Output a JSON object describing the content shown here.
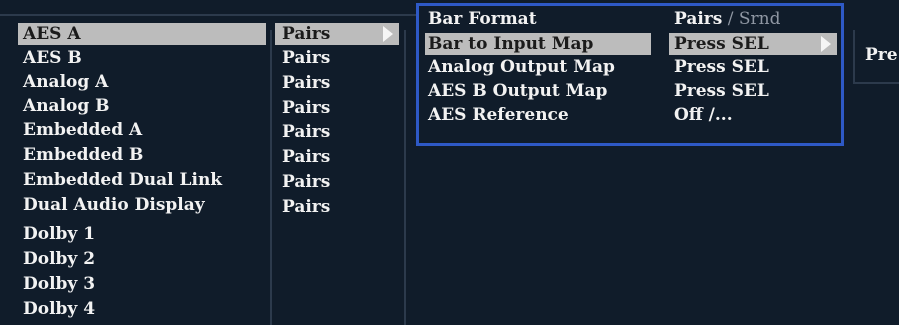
{
  "left_menu": {
    "items": [
      {
        "label": "AES A",
        "value": "Pairs"
      },
      {
        "label": "AES B",
        "value": "Pairs"
      },
      {
        "label": "Analog A",
        "value": "Pairs"
      },
      {
        "label": "Analog B",
        "value": "Pairs"
      },
      {
        "label": "Embedded A",
        "value": "Pairs"
      },
      {
        "label": "Embedded B",
        "value": "Pairs"
      },
      {
        "label": "Embedded Dual Link",
        "value": "Pairs"
      },
      {
        "label": "Dual Audio Display",
        "value": "Pairs"
      },
      {
        "label": "Dolby 1"
      },
      {
        "label": "Dolby 2"
      },
      {
        "label": "Dolby 3"
      },
      {
        "label": "Dolby 4"
      }
    ]
  },
  "submenu": {
    "items": [
      {
        "label": "Bar Format",
        "value": "Pairs",
        "value_alt": " / Srnd"
      },
      {
        "label": "Bar to Input Map",
        "value": "Press SEL"
      },
      {
        "label": "Analog Output Map",
        "value": "Press SEL"
      },
      {
        "label": "AES B Output Map",
        "value": "Press SEL"
      },
      {
        "label": "AES Reference",
        "value": "Off /..."
      }
    ]
  },
  "third_menu": {
    "items": [
      {
        "label": "Pre"
      }
    ]
  },
  "colors": {
    "background": "#101c2a",
    "highlight": "#bcbcbc",
    "focus_border": "#2e59c6"
  }
}
